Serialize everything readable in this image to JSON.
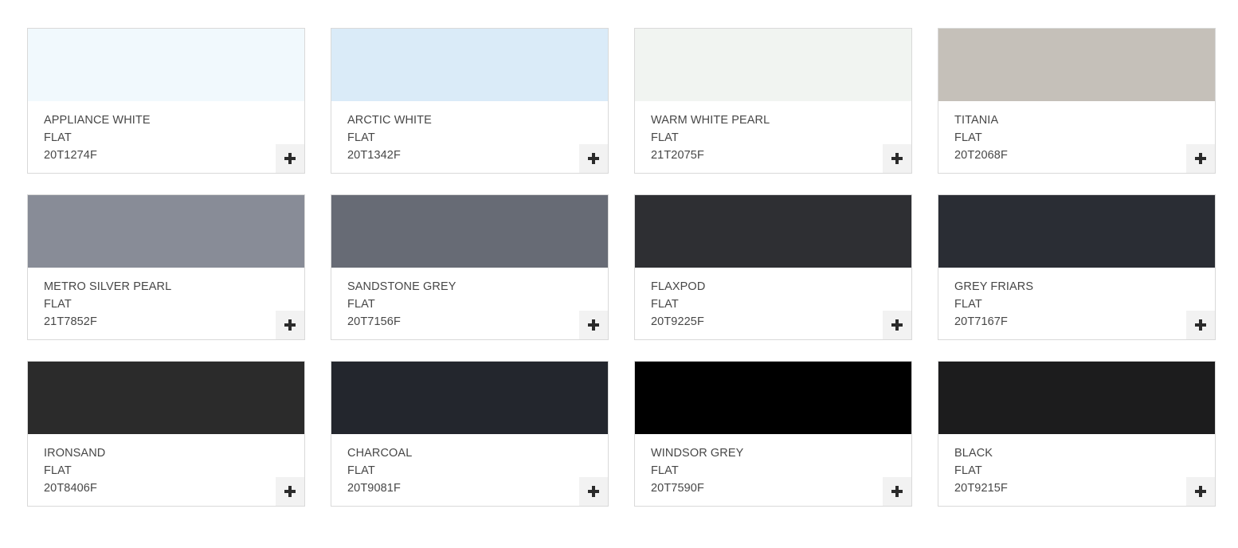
{
  "cards": [
    {
      "name": "APPLIANCE WHITE",
      "finish": "FLAT",
      "code": "20T1274F",
      "color": "#f1f9fd"
    },
    {
      "name": "ARCTIC WHITE",
      "finish": "FLAT",
      "code": "20T1342F",
      "color": "#daebf8"
    },
    {
      "name": "WARM WHITE PEARL",
      "finish": "FLAT",
      "code": "21T2075F",
      "color": "#f1f4f1"
    },
    {
      "name": "TITANIA",
      "finish": "FLAT",
      "code": "20T2068F",
      "color": "#c5c0b9"
    },
    {
      "name": "METRO SILVER PEARL",
      "finish": "FLAT",
      "code": "21T7852F",
      "color": "#888c97"
    },
    {
      "name": "SANDSTONE GREY",
      "finish": "FLAT",
      "code": "20T7156F",
      "color": "#676b75"
    },
    {
      "name": "FLAXPOD",
      "finish": "FLAT",
      "code": "20T9225F",
      "color": "#2e2f33"
    },
    {
      "name": "GREY FRIARS",
      "finish": "FLAT",
      "code": "20T7167F",
      "color": "#2a2d34"
    },
    {
      "name": "IRONSAND",
      "finish": "FLAT",
      "code": "20T8406F",
      "color": "#2b2b2b"
    },
    {
      "name": "CHARCOAL",
      "finish": "FLAT",
      "code": "20T9081F",
      "color": "#23262d"
    },
    {
      "name": "WINDSOR GREY",
      "finish": "FLAT",
      "code": "20T7590F",
      "color": "#000000"
    },
    {
      "name": "BLACK",
      "finish": "FLAT",
      "code": "20T9215F",
      "color": "#1c1c1d"
    }
  ],
  "add_icon": "plus-icon"
}
